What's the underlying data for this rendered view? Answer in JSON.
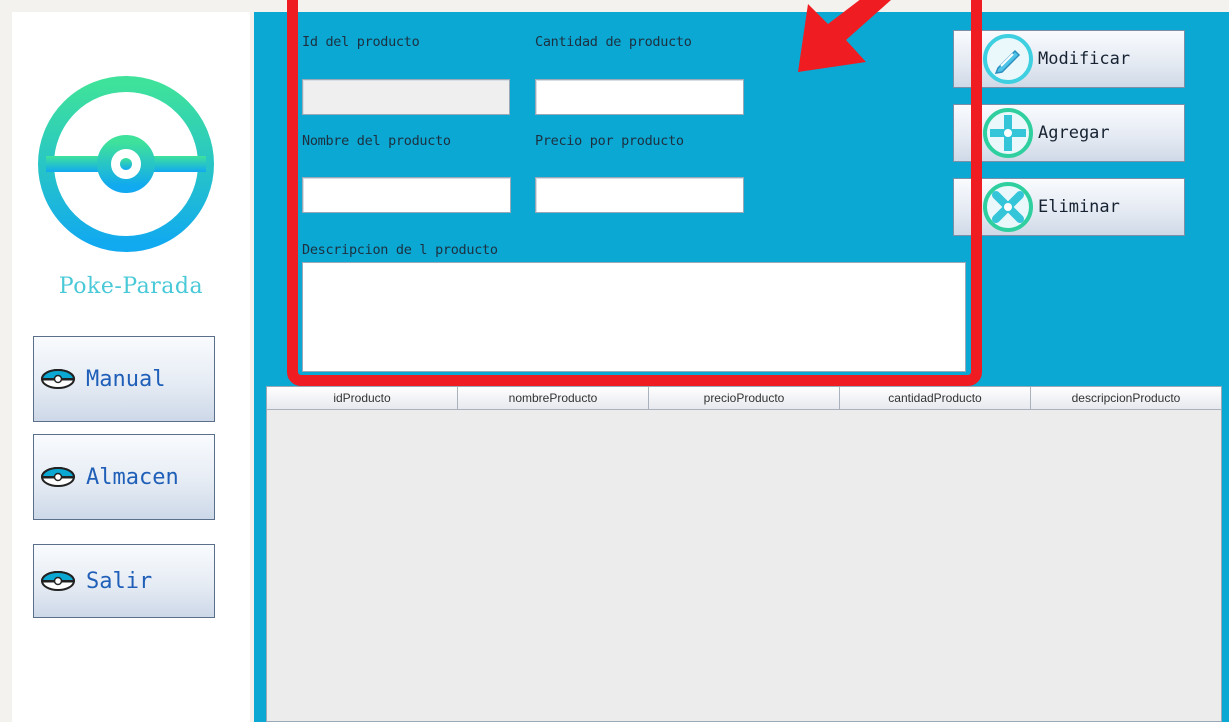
{
  "sidebar": {
    "brand": "Poke-Parada",
    "nav": [
      {
        "label": "Manual",
        "icon": "pokeball-icon"
      },
      {
        "label": "Almacen",
        "icon": "pokeball-icon"
      },
      {
        "label": "Salir",
        "icon": "pokeball-icon"
      }
    ]
  },
  "form": {
    "id_label": "Id del producto",
    "cantidad_label": "Cantidad de producto",
    "nombre_label": "Nombre del producto",
    "precio_label": "Precio por producto",
    "descripcion_label": "Descripcion de l producto",
    "id_value": "",
    "cantidad_value": "",
    "nombre_value": "",
    "precio_value": "",
    "descripcion_value": ""
  },
  "actions": {
    "modificar": "Modificar",
    "agregar": "Agregar",
    "eliminar": "Eliminar"
  },
  "table": {
    "columns": [
      "idProducto",
      "nombreProducto",
      "precioProducto",
      "cantidadProducto",
      "descripcionProducto"
    ]
  },
  "colors": {
    "main_bg": "#0aa8d3",
    "highlight": "#ef1c22",
    "brand": "#49c9d8"
  }
}
